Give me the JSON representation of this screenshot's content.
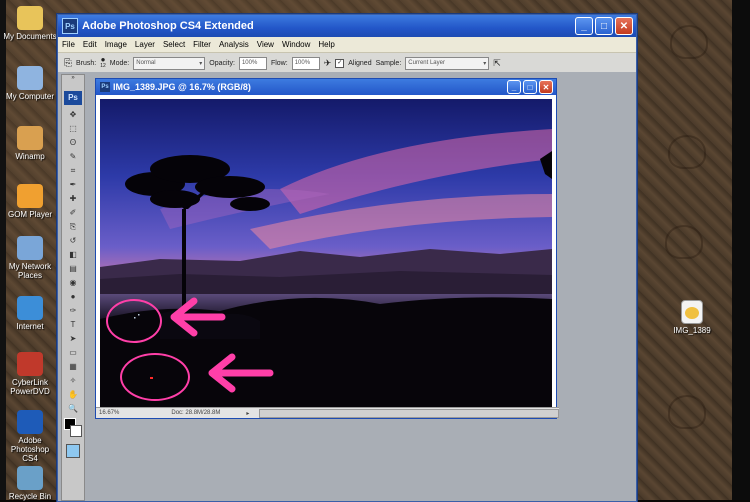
{
  "desktop": {
    "left_icons": [
      {
        "label": "My Documents",
        "color": "#e8c45a"
      },
      {
        "label": "My Computer",
        "color": "#8fb4e0"
      },
      {
        "label": "Winamp",
        "color": "#d9a050"
      },
      {
        "label": "GOM Player",
        "color": "#f0a030"
      },
      {
        "label": "My Network Places",
        "color": "#7aa6d8"
      },
      {
        "label": "Internet",
        "color": "#3c8ed8"
      },
      {
        "label": "CyberLink PowerDVD",
        "color": "#c0392b"
      },
      {
        "label": "Adobe Photoshop CS4",
        "color": "#1e5bb8"
      },
      {
        "label": "Recycle Bin",
        "color": "#6aa0c8"
      }
    ],
    "right_icon": {
      "label": "IMG_1389",
      "color": "#f0c040"
    }
  },
  "app": {
    "title": "Adobe Photoshop CS4 Extended",
    "logo": "Ps",
    "controls": {
      "minimize": "_",
      "maximize": "□",
      "close": "✕"
    }
  },
  "menu": [
    "File",
    "Edit",
    "Image",
    "Layer",
    "Select",
    "Filter",
    "Analysis",
    "View",
    "Window",
    "Help"
  ],
  "options_bar": {
    "brush_label": "Brush:",
    "brush_size": "12",
    "mode_label": "Mode:",
    "mode_value": "Normal",
    "opacity_label": "Opacity:",
    "opacity_value": "100%",
    "flow_label": "Flow:",
    "flow_value": "100%",
    "aligned_label": "Aligned",
    "aligned_checked": true,
    "sample_label": "Sample:",
    "sample_value": "Current Layer"
  },
  "tools": {
    "logo": "Ps",
    "items": [
      "move-tool",
      "marquee-tool",
      "lasso-tool",
      "quick-selection-tool",
      "crop-tool",
      "eyedropper-tool",
      "healing-brush-tool",
      "brush-tool",
      "clone-stamp-tool",
      "history-brush-tool",
      "eraser-tool",
      "gradient-tool",
      "blur-tool",
      "dodge-tool",
      "pen-tool",
      "type-tool",
      "path-selection-tool",
      "shape-tool",
      "notes-tool",
      "eyedropper-3d-tool",
      "hand-tool",
      "zoom-tool"
    ],
    "glyphs": [
      "✥",
      "⬚",
      "ʘ",
      "✎",
      "⌗",
      "✒",
      "✚",
      "✐",
      "⎘",
      "↺",
      "◧",
      "▤",
      "◉",
      "●",
      "✑",
      "T",
      "➤",
      "▭",
      "▦",
      "✧",
      "✋",
      "🔍"
    ]
  },
  "document": {
    "title": "IMG_1389.JPG @ 16.7% (RGB/8)",
    "zoom": "16.67%",
    "doc_info": "Doc: 28.8M/28.8M"
  },
  "annotations": {
    "color": "#ff3fa8"
  }
}
